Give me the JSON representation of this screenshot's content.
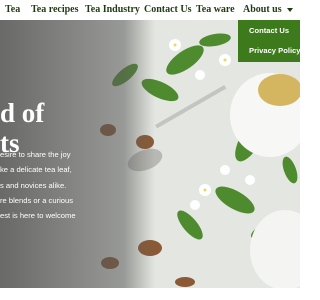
{
  "nav": {
    "items": [
      "Tea",
      "Tea recipes",
      "Tea Industry",
      "Contact Us",
      "Tea ware",
      "About us"
    ]
  },
  "dropdown": {
    "items": [
      "Contact Us",
      "Privacy Policy"
    ]
  },
  "hero": {
    "heading_lines": [
      "d of",
      "ts"
    ],
    "text_lines": [
      "esire to share the joy",
      "ke a delicate tea leaf,",
      "s and novices alike.",
      "re blends or a curious",
      "est is here to welcome"
    ]
  },
  "colors": {
    "nav_text": "#1f3a12",
    "dropdown_bg": "#3d7a1c",
    "hero_text": "#ffffff"
  },
  "icons": {
    "about_caret": "chevron-down-icon"
  }
}
